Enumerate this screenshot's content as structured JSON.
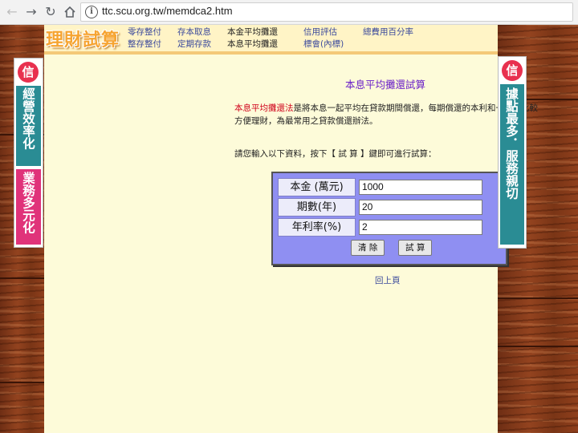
{
  "browser": {
    "url": "ttc.scu.org.tw/memdca2.htm"
  },
  "header": {
    "logo": "理財試算",
    "nav_row1": [
      "零存整付",
      "存本取息",
      "本金平均攤還",
      "信用評估",
      "總費用百分率"
    ],
    "nav_row2": [
      "整存整付",
      "定期存款",
      "本息平均攤還",
      "標會(內標)"
    ]
  },
  "main": {
    "title": "本息平均攤還試算",
    "intro_highlight": "本息平均攤還法",
    "intro_rest": "是將本息一起平均在貸款期間償還，每期償還的本利和一樣，比較方便理財，為最常用之貸款償還辦法。",
    "prompt": "請您輸入以下資料，按下【 試 算 】鍵即可進行試算：",
    "form": {
      "principal_label": "本金 (萬元)",
      "principal_value": "1000",
      "periods_label": "期數(年)",
      "periods_value": "20",
      "rate_label": "年利率(%)",
      "rate_value": "2",
      "clear_label": "清 除",
      "calc_label": "試 算"
    },
    "back_label": "回上頁"
  },
  "left_banner": {
    "top_text": "經營效率化",
    "bottom_text": "業務多元化"
  },
  "right_banner": {
    "text": "據點最多．服務親切"
  },
  "colors": {
    "page_bg": "#fdfbd9",
    "title": "#6b21c8",
    "highlight": "#d0021b",
    "link": "#3b4a9c",
    "form_bg": "#8f8ff2",
    "banner_teal": "#2a8c94",
    "banner_pink": "#e0337a"
  }
}
